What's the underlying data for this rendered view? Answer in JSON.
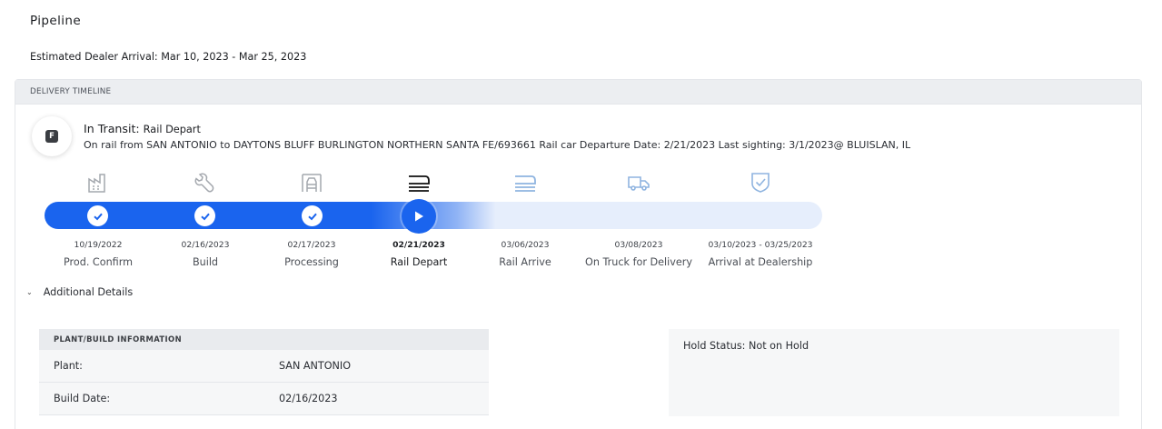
{
  "page": {
    "title": "Pipeline",
    "estimated_arrival": "Estimated Dealer Arrival: Mar 10, 2023 - Mar 25, 2023"
  },
  "timeline": {
    "header": "DELIVERY TIMELINE",
    "badge_letter": "F",
    "status_label": "In Transit: ",
    "status_value": "Rail Depart",
    "description": "On rail from SAN ANTONIO to DAYTONS BLUFF BURLINGTON NORTHERN SANTA FE/693661 Rail car Departure Date: 2/21/2023 Last sighting: 3/1/2023@ BLUISLAN, IL",
    "progress_fraction": 0.5,
    "steps": [
      {
        "date": "10/19/2022",
        "label": "Prod. Confirm",
        "state": "complete",
        "icon": "factory-icon"
      },
      {
        "date": "02/16/2023",
        "label": "Build",
        "state": "complete",
        "icon": "wrench-icon"
      },
      {
        "date": "02/17/2023",
        "label": "Processing",
        "state": "complete",
        "icon": "garage-icon"
      },
      {
        "date": "02/21/2023",
        "label": "Rail Depart",
        "state": "current",
        "icon": "rail-car-icon"
      },
      {
        "date": "03/06/2023",
        "label": "Rail Arrive",
        "state": "upcoming",
        "icon": "rail-car-icon"
      },
      {
        "date": "03/08/2023",
        "label": "On Truck for Delivery",
        "state": "upcoming",
        "icon": "truck-icon"
      },
      {
        "date": "03/10/2023 - 03/25/2023",
        "label": "Arrival at Dealership",
        "state": "upcoming",
        "icon": "shield-check-icon"
      }
    ]
  },
  "details": {
    "toggle_label": "Additional Details",
    "plant_table": {
      "header": "PLANT/BUILD INFORMATION",
      "rows": [
        {
          "key": "Plant:",
          "value": "SAN ANTONIO"
        },
        {
          "key": "Build Date:",
          "value": "02/16/2023"
        }
      ]
    },
    "hold_status": "Hold Status: Not on Hold"
  },
  "colors": {
    "accent": "#1a64ee",
    "track_pending": "#e6eefc",
    "icon_complete": "#a4a8ae",
    "icon_current": "#111111",
    "icon_upcoming": "#8fb4e0"
  }
}
